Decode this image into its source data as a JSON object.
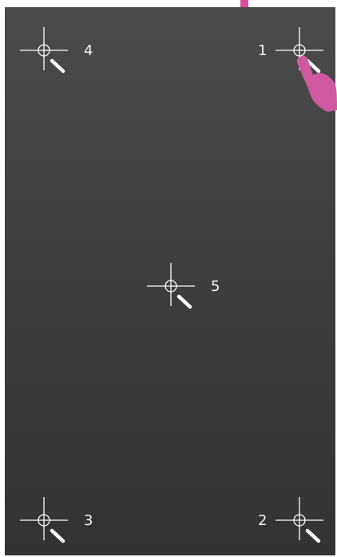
{
  "calibration": {
    "targets": [
      {
        "id": 1,
        "label": "1"
      },
      {
        "id": 2,
        "label": "2"
      },
      {
        "id": 3,
        "label": "3"
      },
      {
        "id": 4,
        "label": "4"
      },
      {
        "id": 5,
        "label": "5"
      }
    ]
  },
  "icons": {
    "crosshair": "calibration-crosshair-icon",
    "hand": "pointing-hand-icon",
    "arrow": "down-arrow-icon"
  },
  "colors": {
    "background_top": "#4b4b4b",
    "background_bottom": "#333333",
    "crosshair": "#ffffff",
    "label": "#f2f2f2",
    "pointer_accent": "#d15aa0"
  }
}
